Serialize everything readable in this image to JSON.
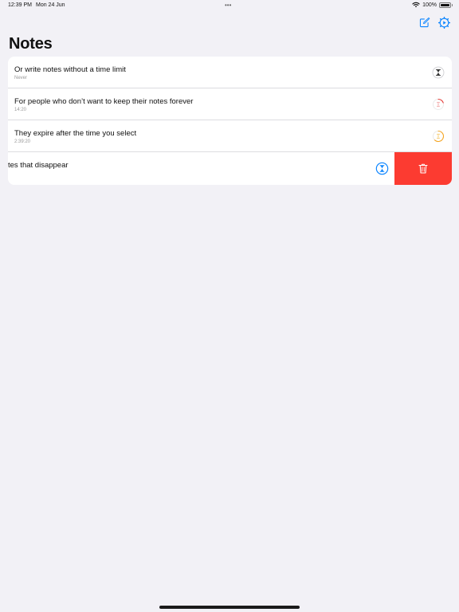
{
  "status_bar": {
    "time": "12:39 PM",
    "date": "Mon 24 Jun",
    "battery": "100%",
    "battery_level": 1.0
  },
  "toolbar": {
    "compose_icon": "compose-icon",
    "settings_icon": "settings-timer-icon",
    "accent_color": "#0a84ff"
  },
  "page": {
    "title": "Notes"
  },
  "notes": [
    {
      "title": "Or write notes without a time limit",
      "subtitle": "Never",
      "icon": "hourglass-icon",
      "icon_color": "#333333",
      "progress": 0
    },
    {
      "title": "For people who don’t want to keep their notes forever",
      "subtitle": "14:20",
      "icon": "timer-ring-icon",
      "icon_color": "#e53935",
      "progress": 0.3
    },
    {
      "title": "They expire after the time you select",
      "subtitle": "2:39:20",
      "icon": "timer-ring-icon",
      "icon_color": "#f5a623",
      "progress": 0.6
    }
  ],
  "swiped_note": {
    "title": "tes that disappear",
    "icon": "timer-active-icon",
    "icon_color": "#0a84ff"
  },
  "swipe_action": {
    "icon": "trash-icon",
    "color": "#fc3b31"
  }
}
